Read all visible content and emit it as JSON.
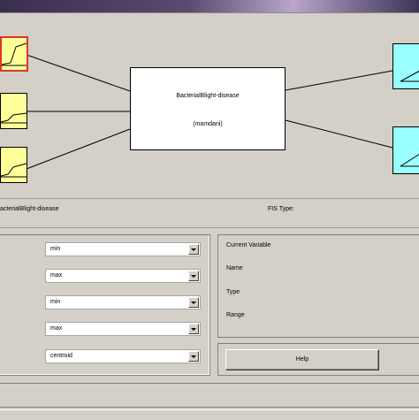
{
  "system": {
    "name": "BacterialBlight-disease",
    "type": "(mamdani)"
  },
  "info_bar": {
    "fis_name_value": "acterialBlight-disease",
    "fis_type_label": "FIS Type:"
  },
  "methods": [
    {
      "value": "min"
    },
    {
      "value": "max"
    },
    {
      "value": "min"
    },
    {
      "value": "max"
    },
    {
      "value": "centroid"
    }
  ],
  "variable_panel": {
    "current_variable_label": "Current Variable",
    "name_label": "Name",
    "type_label": "Type",
    "range_label": "Range"
  },
  "help": {
    "label": "Help"
  },
  "colors": {
    "input_box": "#ffff99",
    "output_box": "#99ffff",
    "selected_border": "#e0352b",
    "background": "#d4d0c8"
  },
  "icons": {
    "input_mf": "membership-function-curve-icon",
    "output_mf": "triangle-membership-icon",
    "dropdown": "chevron-down-icon"
  }
}
